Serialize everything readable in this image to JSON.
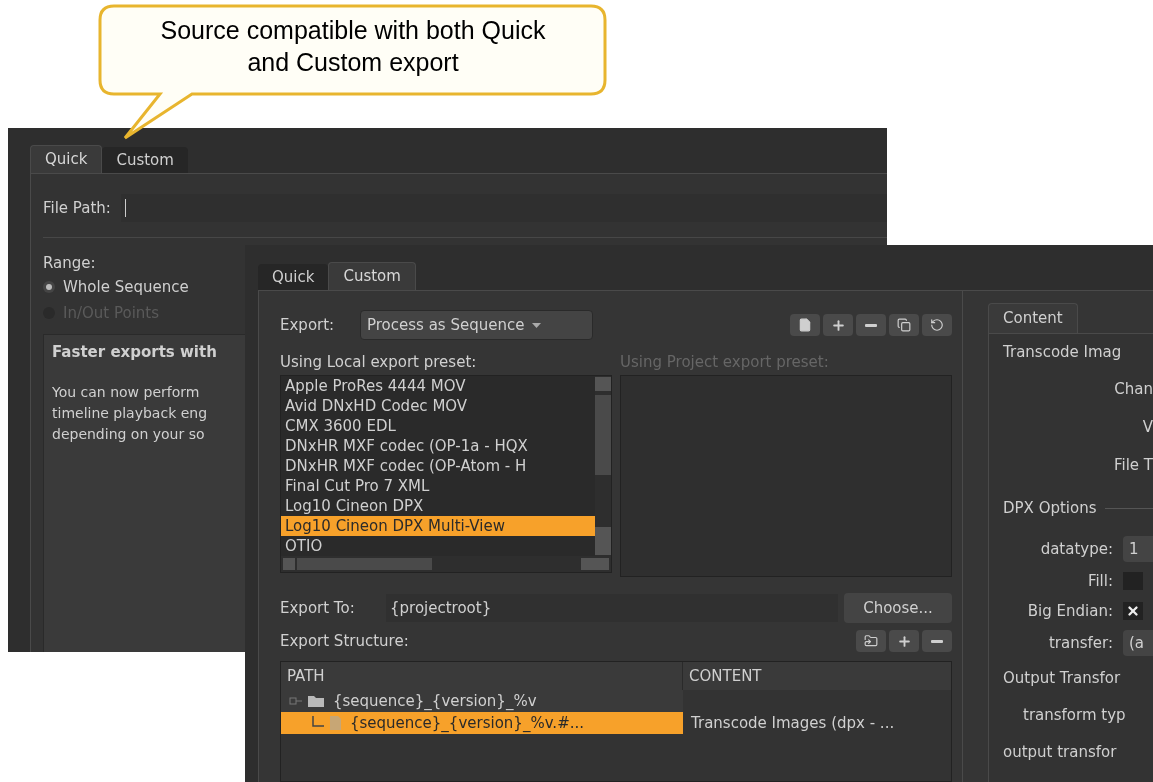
{
  "callout": {
    "text": "Source compatible with both Quick and Custom export"
  },
  "back_window": {
    "tabs": [
      {
        "label": "Quick",
        "selected": true
      },
      {
        "label": "Custom",
        "selected": false
      }
    ],
    "file_path": {
      "label": "File Path:"
    },
    "range": {
      "label": "Range:",
      "options": [
        {
          "label": "Whole Sequence",
          "selected": true,
          "disabled": false
        },
        {
          "label": "In/Out Points",
          "selected": false,
          "disabled": true
        }
      ]
    },
    "info": {
      "heading": "Faster exports with",
      "lines": [
        "You can now perform",
        "timeline playback eng",
        "depending on your so"
      ]
    }
  },
  "front_window": {
    "tabs": [
      {
        "label": "Quick",
        "selected": false
      },
      {
        "label": "Custom",
        "selected": true
      }
    ],
    "export": {
      "label": "Export:",
      "value": "Process as Sequence"
    },
    "local_presets": {
      "label": "Using Local export preset:",
      "items": [
        {
          "label": "Apple ProRes 4444 MOV",
          "selected": false
        },
        {
          "label": "Avid DNxHD Codec MOV",
          "selected": false
        },
        {
          "label": "CMX 3600 EDL",
          "selected": false
        },
        {
          "label": "DNxHR MXF codec (OP-1a - HQX",
          "selected": false
        },
        {
          "label": "DNxHR MXF codec (OP-Atom - H",
          "selected": false
        },
        {
          "label": "Final Cut Pro 7 XML",
          "selected": false
        },
        {
          "label": "Log10 Cineon DPX",
          "selected": false
        },
        {
          "label": "Log10 Cineon DPX Multi-View",
          "selected": true
        },
        {
          "label": "OTIO",
          "selected": false
        }
      ]
    },
    "project_presets": {
      "label": "Using Project export preset:",
      "disabled": true
    },
    "export_to": {
      "label": "Export To:",
      "value": "{projectroot}",
      "button": "Choose..."
    },
    "structure": {
      "label": "Export Structure:",
      "columns": [
        "PATH",
        "CONTENT"
      ],
      "rows": [
        {
          "kind": "folder",
          "path": "{sequence}_{version}_%v",
          "selected": false,
          "children": [
            {
              "kind": "file",
              "path": "{sequence}_{version}_%v.#...",
              "content": "Transcode Images (dpx - ...",
              "selected": true
            }
          ]
        }
      ]
    },
    "content_panel": {
      "tab": "Content",
      "fields": [
        {
          "kind": "heading",
          "label": "Transcode Imag"
        },
        {
          "kind": "right_label",
          "label": "Chan"
        },
        {
          "kind": "right_label",
          "label": "V"
        },
        {
          "kind": "right_label",
          "label": "File T"
        },
        {
          "kind": "section",
          "label": "DPX Options"
        },
        {
          "kind": "dropdown",
          "label": "datatype:",
          "value": "1"
        },
        {
          "kind": "checkbox",
          "label": "Fill:",
          "checked": false
        },
        {
          "kind": "checkbox",
          "label": "Big Endian:",
          "checked": true
        },
        {
          "kind": "dropdown",
          "label": "transfer:",
          "value": "(a"
        },
        {
          "kind": "heading",
          "label": "Output Transfor"
        },
        {
          "kind": "indented",
          "label": "transform typ"
        },
        {
          "kind": "heading",
          "label": "output transfor"
        }
      ]
    }
  }
}
